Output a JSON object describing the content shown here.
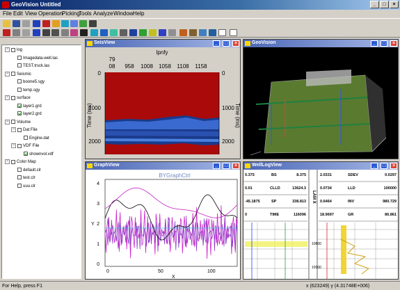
{
  "window": {
    "title": "GeoVision  Untitled",
    "min": "_",
    "max": "□",
    "close": "×"
  },
  "menu": [
    "File",
    "Edit",
    "View",
    "Operation",
    "Picking",
    "Tools",
    "Analyze",
    "Window",
    "Help"
  ],
  "tree": [
    {
      "label": "log",
      "indent": 0,
      "checked": false,
      "expander": "−"
    },
    {
      "label": "Imagedata-well.las",
      "indent": 2,
      "checked": false
    },
    {
      "label": "TEST.trsck.las",
      "indent": 2,
      "checked": false
    },
    {
      "label": "Seismic",
      "indent": 0,
      "checked": false,
      "expander": "−"
    },
    {
      "label": "boone5.sgy",
      "indent": 2,
      "checked": false
    },
    {
      "label": "temp.sgy",
      "indent": 2,
      "checked": false
    },
    {
      "label": "surface",
      "indent": 0,
      "checked": false,
      "expander": "−"
    },
    {
      "label": "layer1.grd",
      "indent": 2,
      "checked": true
    },
    {
      "label": "layer2.grd",
      "indent": 2,
      "checked": true
    },
    {
      "label": "Volume",
      "indent": 0,
      "checked": false,
      "expander": "−"
    },
    {
      "label": "Dat File",
      "indent": 1,
      "checked": false,
      "expander": "−"
    },
    {
      "label": "Engine.dat",
      "indent": 3,
      "checked": false
    },
    {
      "label": "VDF File",
      "indent": 1,
      "checked": false,
      "expander": "−"
    },
    {
      "label": "shownvol.vdf",
      "indent": 3,
      "checked": true
    },
    {
      "label": "Color Map",
      "indent": 0,
      "checked": false,
      "expander": "−"
    },
    {
      "label": "default.clr",
      "indent": 2,
      "checked": false
    },
    {
      "label": "test.clr",
      "indent": 2,
      "checked": false
    },
    {
      "label": "uuu.clr",
      "indent": 2,
      "checked": false
    }
  ],
  "seisview": {
    "title": "SeisView",
    "topaxis_label": "lpnfy",
    "top_ticks": [
      "79",
      "08",
      "958",
      "1008",
      "1058",
      "1108",
      "1158"
    ],
    "left_ticks": [
      "0",
      "1000",
      "2000"
    ],
    "left_label": "Time (ms)",
    "right_ticks": [
      "0",
      "1000",
      "2000"
    ],
    "right_label": "Time (ms)"
  },
  "geovision3d": {
    "title": "GeoVision"
  },
  "graphview": {
    "title": "GraphView",
    "caption": "BYGraphCtrl",
    "xlabel": "X",
    "ylabel": "Y",
    "xticks": [
      "0",
      "50",
      "100"
    ],
    "yticks": [
      "0",
      "1",
      "2",
      "3",
      "4"
    ]
  },
  "wellview": {
    "title": "WellLogView",
    "mid_label": "LAM X",
    "left_rows": [
      {
        "a": "0.375",
        "b": "BS",
        "c": "8.375"
      },
      {
        "a": "0.01",
        "b": "CLLD",
        "c": "13624.3"
      },
      {
        "a": "-45.1875",
        "b": "SP",
        "c": "338.813"
      },
      {
        "a": "0",
        "b": "TIME",
        "c": "116096"
      }
    ],
    "right_rows": [
      {
        "a": "2.0331",
        "b": "SDEV",
        "c": "0.0297"
      },
      {
        "a": "0.0734",
        "b": "LLD",
        "c": "100000"
      },
      {
        "a": "0.6464",
        "b": "INV",
        "c": "980.729"
      },
      {
        "a": "18.9697",
        "b": "GR",
        "c": "86.861"
      }
    ],
    "depths": [
      "10800",
      "10900"
    ]
  },
  "status": {
    "left": "For Help, press F1",
    "right": "x (623249) y (4.31748E+006)"
  }
}
